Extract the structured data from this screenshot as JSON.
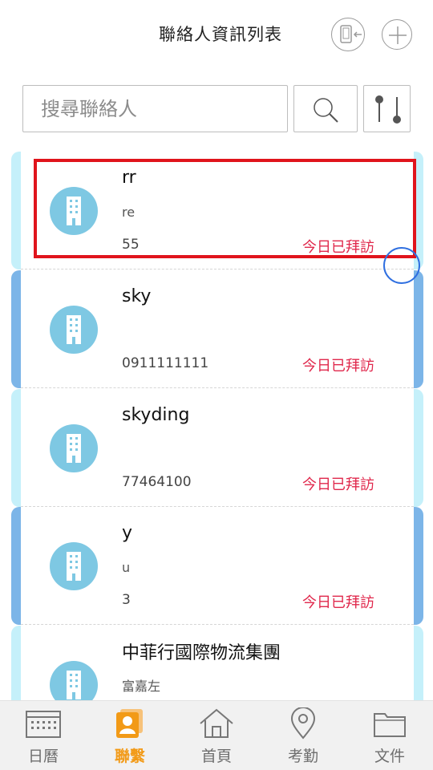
{
  "header": {
    "title": "聯絡人資訊列表",
    "switch_icon": "switch-device-icon",
    "add_icon": "plus-icon"
  },
  "search": {
    "placeholder": "搜尋聯絡人",
    "search_icon": "magnifier-icon",
    "filter_icon": "slider-filter-icon"
  },
  "contacts": [
    {
      "name": "rr",
      "sub": "re",
      "phone": "55",
      "status": "今日已拜訪",
      "accent": "#c5f0fa"
    },
    {
      "name": "sky",
      "sub": "",
      "phone": "0911111111",
      "status": "今日已拜訪",
      "accent": "#7cb5e8"
    },
    {
      "name": "skyding",
      "sub": "",
      "phone": "77464100",
      "status": "今日已拜訪",
      "accent": "#c5f0fa"
    },
    {
      "name": "y",
      "sub": "u",
      "phone": "3",
      "status": "今日已拜訪",
      "accent": "#7cb5e8"
    },
    {
      "name": "中菲行國際物流集團",
      "sub": "富嘉左",
      "phone": "",
      "status": "",
      "accent": "#c5f0fa"
    }
  ],
  "tabs": [
    {
      "label": "日曆",
      "icon": "calendar-icon",
      "active": false
    },
    {
      "label": "聯繫",
      "icon": "contact-card-icon",
      "active": true
    },
    {
      "label": "首頁",
      "icon": "home-icon",
      "active": false
    },
    {
      "label": "考勤",
      "icon": "location-pin-icon",
      "active": false
    },
    {
      "label": "文件",
      "icon": "folder-icon",
      "active": false
    }
  ],
  "colors": {
    "accent_active": "#f29a17",
    "visited_text": "#e0284c",
    "avatar": "#7ec8e3",
    "highlight": "#e0141c"
  }
}
